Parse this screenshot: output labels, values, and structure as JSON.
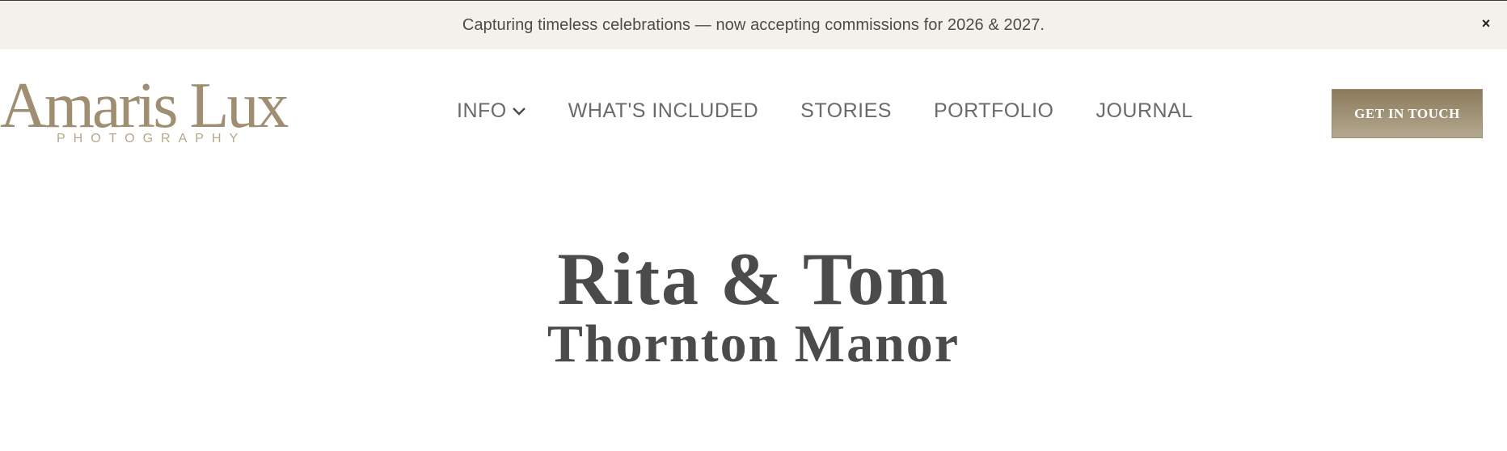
{
  "announcement": {
    "text": "Capturing timeless celebrations — now accepting commissions for 2026 & 2027.",
    "close_symbol": "×"
  },
  "logo": {
    "main": "Amaris Lux",
    "sub": "PHOTOGRAPHY"
  },
  "nav": {
    "items": [
      {
        "label": "INFO",
        "has_dropdown": true
      },
      {
        "label": "WHAT'S INCLUDED"
      },
      {
        "label": "STORIES"
      },
      {
        "label": "PORTFOLIO"
      },
      {
        "label": "JOURNAL"
      }
    ]
  },
  "cta": {
    "label": "GET IN TOUCH"
  },
  "hero": {
    "title": "Rita & Tom",
    "subtitle": "Thornton Manor"
  },
  "colors": {
    "announcement_bg": "#f2f1ec",
    "brand": "#a08e72",
    "cta_gradient_top": "#8b7a5c",
    "cta_gradient_bottom": "#b4a98f",
    "text": "#4b4b4b"
  },
  "icons": [
    "close-icon",
    "chevron-down-icon"
  ]
}
